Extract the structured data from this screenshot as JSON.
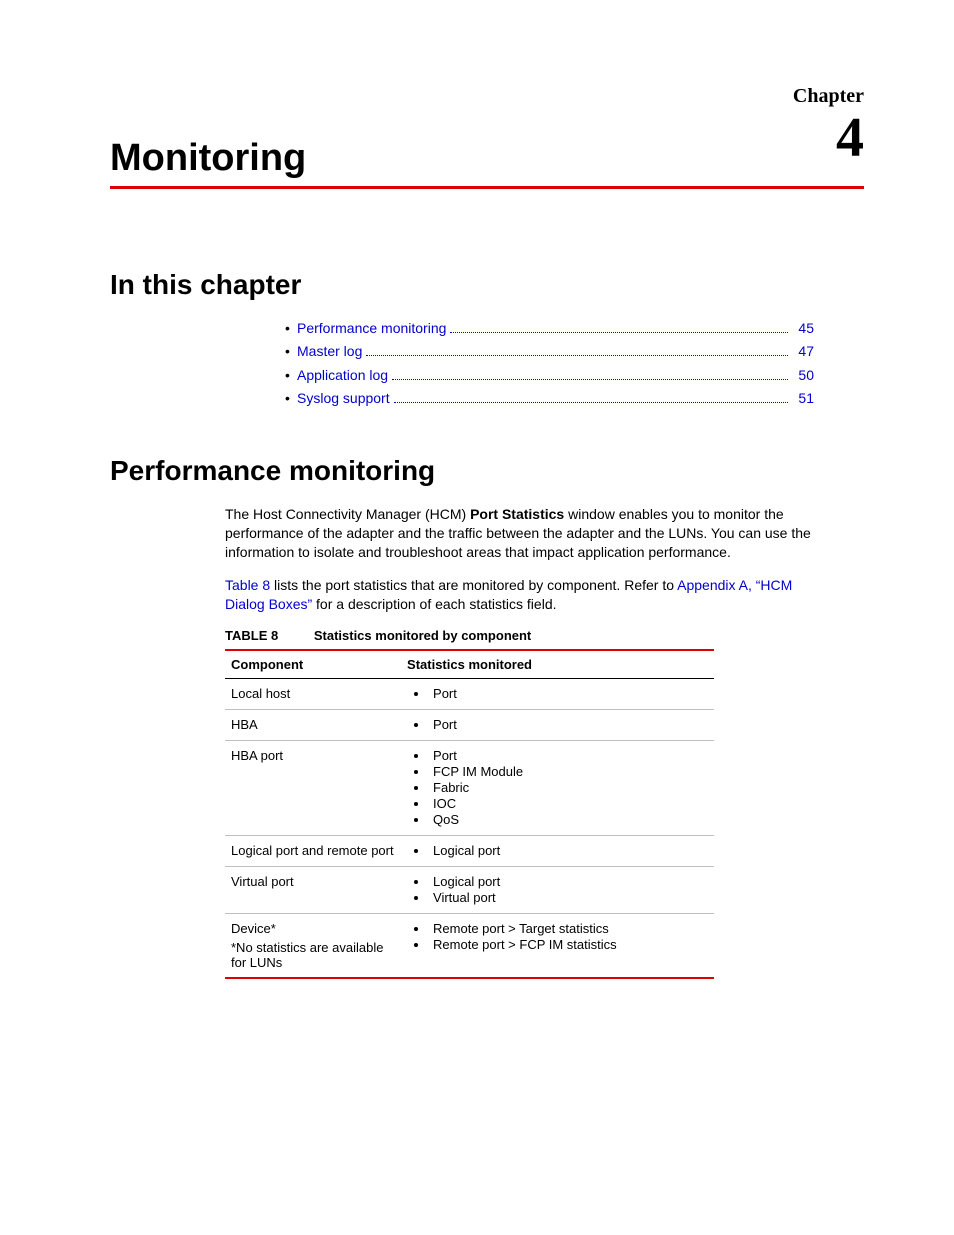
{
  "header": {
    "chapter_label": "Chapter",
    "chapter_number": "4",
    "chapter_title": "Monitoring"
  },
  "sections": {
    "in_this_chapter": "In this chapter",
    "performance_monitoring": "Performance monitoring"
  },
  "toc": [
    {
      "label": "Performance monitoring",
      "page": "45"
    },
    {
      "label": "Master log",
      "page": "47"
    },
    {
      "label": "Application log",
      "page": "50"
    },
    {
      "label": "Syslog support",
      "page": "51"
    }
  ],
  "body": {
    "p1_pre": "The Host Connectivity Manager (HCM) ",
    "p1_bold": "Port Statistics",
    "p1_post": " window enables you to monitor the performance of the adapter and the traffic between the adapter and the LUNs. You can use the information to isolate and troubleshoot areas that impact application performance.",
    "p2_link1": "Table 8",
    "p2_mid": " lists the port statistics that are monitored by component. Refer to ",
    "p2_link2": "Appendix A, “HCM Dialog Boxes”",
    "p2_post": " for a description of each statistics field."
  },
  "table": {
    "caption_label": "TABLE 8",
    "caption_title": "Statistics monitored by component",
    "headers": {
      "col1": "Component",
      "col2": "Statistics monitored"
    },
    "rows": [
      {
        "component": "Local host",
        "stats": [
          "Port"
        ]
      },
      {
        "component": "HBA",
        "stats": [
          "Port"
        ]
      },
      {
        "component": "HBA port",
        "stats": [
          "Port",
          "FCP IM Module",
          "Fabric",
          "IOC",
          "QoS"
        ]
      },
      {
        "component": "Logical port and remote port",
        "stats": [
          "Logical port"
        ]
      },
      {
        "component": "Virtual port",
        "stats": [
          "Logical port",
          "Virtual port"
        ]
      },
      {
        "component": "Device*",
        "stats": [
          "Remote port > Target statistics",
          "Remote port > FCP IM statistics"
        ],
        "footnote": "*No statistics are available for LUNs"
      }
    ]
  }
}
